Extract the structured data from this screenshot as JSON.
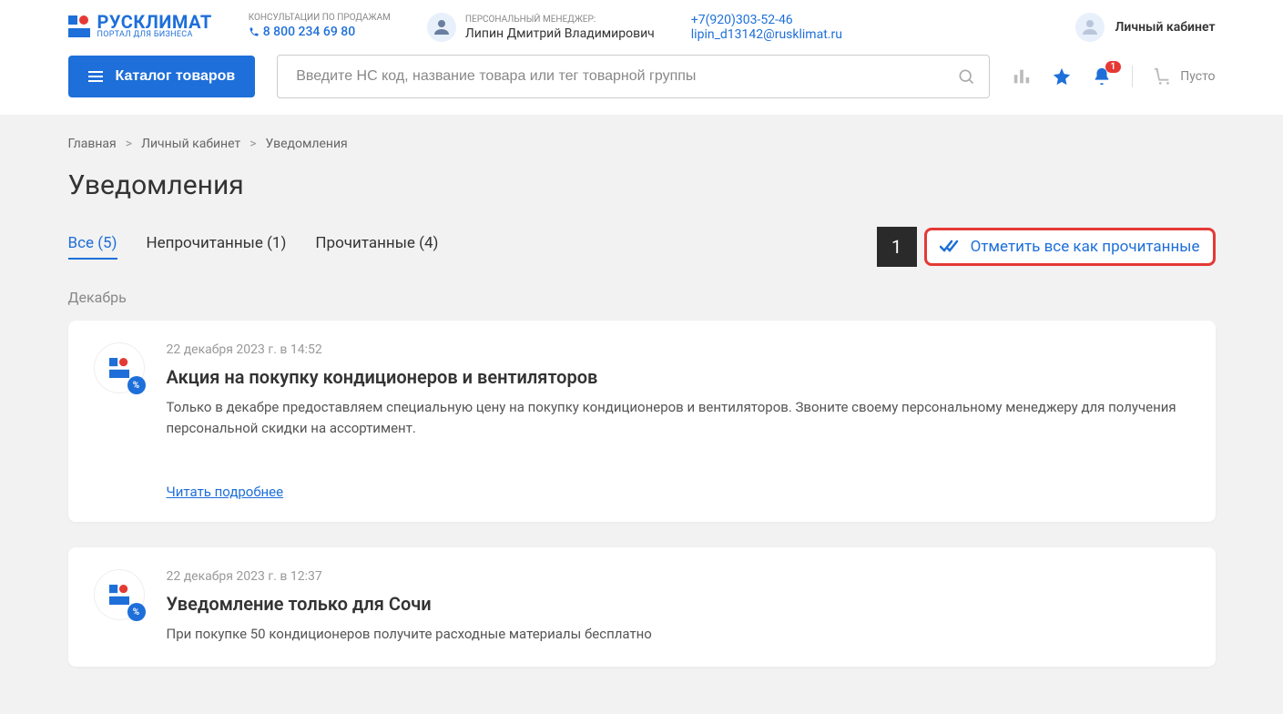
{
  "header": {
    "logo_main": "РУСКЛИМАТ",
    "logo_sub": "ПОРТАЛ ДЛЯ БИЗНЕСА",
    "consult_label": "КОНСУЛЬТАЦИИ ПО ПРОДАЖАМ",
    "consult_phone": "8 800 234 69 80",
    "manager_label": "ПЕРСОНАЛЬНЫЙ МЕНЕДЖЕР:",
    "manager_name": "Липин Дмитрий Владимирович",
    "contact_phone": "+7(920)303-52-46",
    "contact_email": "lipin_d13142@rusklimat.ru",
    "account_label": "Личный кабинет"
  },
  "toolbar": {
    "catalog_label": "Каталог товаров",
    "search_placeholder": "Введите НС код, название товара или тег товарной группы",
    "notif_badge": "1",
    "cart_label": "Пусто"
  },
  "breadcrumb": {
    "home": "Главная",
    "account": "Личный кабинет",
    "current": "Уведомления"
  },
  "page": {
    "title": "Уведомления"
  },
  "tabs": {
    "all": "Все (5)",
    "unread": "Непрочитанные (1)",
    "read": "Прочитанные (4)"
  },
  "actions": {
    "mark_all_read": "Отметить все как прочитанные",
    "callout_num": "1"
  },
  "month": "Декабрь",
  "notifications": [
    {
      "date": "22 декабря 2023 г. в 14:52",
      "title": "Акция на покупку кондиционеров и вентиляторов",
      "text": "Только в декабре предоставляем специальную цену на покупку кондиционеров и вентиляторов. Звоните своему персональному менеджеру для получения персональной скидки на ассортимент.",
      "link": "Читать подробнее"
    },
    {
      "date": "22 декабря 2023 г. в 12:37",
      "title": "Уведомление только для Сочи",
      "text": "При покупке 50 кондиционеров получите расходные материалы бесплатно",
      "link": ""
    }
  ]
}
